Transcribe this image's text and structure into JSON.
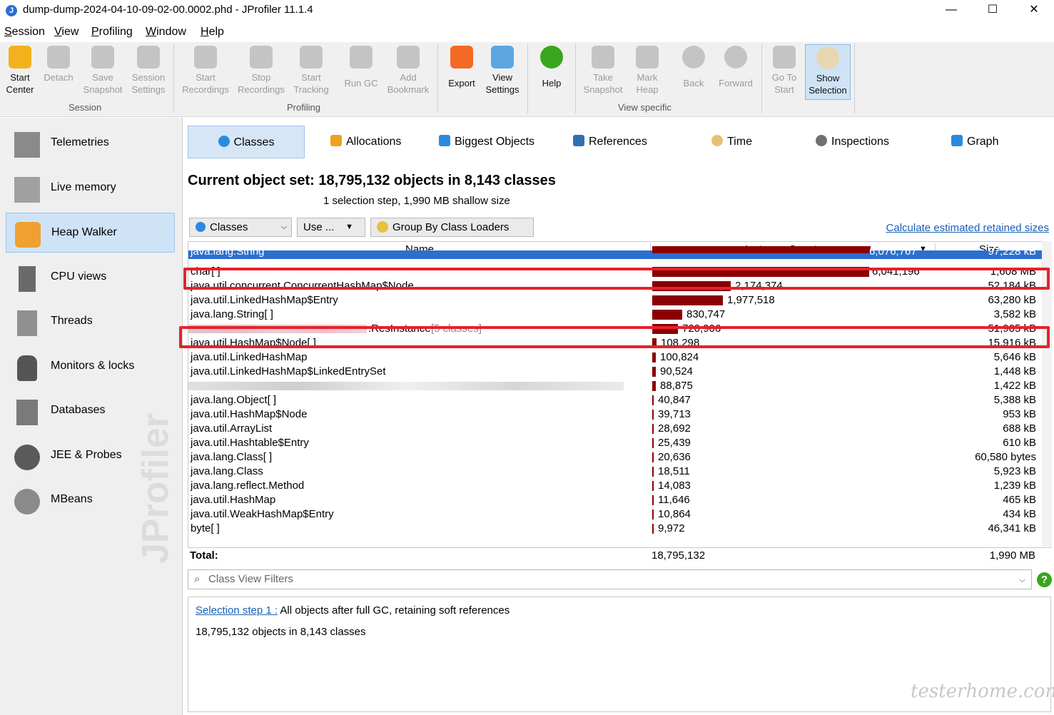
{
  "window": {
    "title": "dump-dump-2024-04-10-09-02-00.0002.phd - JProfiler 11.1.4",
    "minimize": "—",
    "maximize": "☐",
    "close": "✕"
  },
  "menu": [
    "Session",
    "View",
    "Profiling",
    "Window",
    "Help"
  ],
  "toolbar": {
    "buttons": [
      {
        "label": "Start\nCenter",
        "icon": "start-center-icon"
      },
      {
        "label": "Detach",
        "icon": "detach-icon"
      },
      {
        "label": "Save\nSnapshot",
        "icon": "save-snapshot-icon"
      },
      {
        "label": "Session\nSettings",
        "icon": "session-settings-icon"
      },
      {
        "label": "Start\nRecordings",
        "icon": "start-recordings-icon"
      },
      {
        "label": "Stop\nRecordings",
        "icon": "stop-recordings-icon"
      },
      {
        "label": "Start\nTracking",
        "icon": "start-tracking-icon"
      },
      {
        "label": "Run GC",
        "icon": "run-gc-icon"
      },
      {
        "label": "Add\nBookmark",
        "icon": "add-bookmark-icon"
      },
      {
        "label": "Export",
        "icon": "export-icon"
      },
      {
        "label": "View\nSettings",
        "icon": "view-settings-icon"
      },
      {
        "label": "Help",
        "icon": "help-icon"
      },
      {
        "label": "Take\nSnapshot",
        "icon": "take-snapshot-icon"
      },
      {
        "label": "Mark\nHeap",
        "icon": "mark-heap-icon"
      },
      {
        "label": "Back",
        "icon": "back-icon"
      },
      {
        "label": "Forward",
        "icon": "forward-icon"
      },
      {
        "label": "Go To\nStart",
        "icon": "go-to-start-icon"
      },
      {
        "label": "Show\nSelection",
        "icon": "show-selection-icon"
      }
    ],
    "groups": [
      "Session",
      "Profiling",
      "View specific"
    ]
  },
  "sidebar": {
    "items": [
      {
        "label": "Telemetries",
        "icon": "telemetries-icon"
      },
      {
        "label": "Live memory",
        "icon": "live-memory-icon"
      },
      {
        "label": "Heap Walker",
        "icon": "heap-walker-icon"
      },
      {
        "label": "CPU views",
        "icon": "cpu-views-icon"
      },
      {
        "label": "Threads",
        "icon": "threads-icon"
      },
      {
        "label": "Monitors & locks",
        "icon": "monitors-locks-icon"
      },
      {
        "label": "Databases",
        "icon": "databases-icon"
      },
      {
        "label": "JEE & Probes",
        "icon": "jee-probes-icon"
      },
      {
        "label": "MBeans",
        "icon": "mbeans-icon"
      }
    ],
    "watermark": "JProfiler"
  },
  "tabs": [
    "Classes",
    "Allocations",
    "Biggest Objects",
    "References",
    "Time",
    "Inspections",
    "Graph"
  ],
  "heading": {
    "title": "Current object set:  18,795,132 objects in 8,143 classes",
    "subtitle": "1 selection step, 1,990 MB shallow size"
  },
  "controls": {
    "view_select": "Classes",
    "use_button": "Use ...",
    "group_button": "Group By Class Loaders",
    "calc_link": "Calculate estimated retained sizes"
  },
  "table": {
    "columns": [
      "Name",
      "Instance Count",
      "Size"
    ],
    "rows": [
      {
        "name": "java.lang.String",
        "count": "6,076,767",
        "size": "97,228 kB",
        "fraction": 1.0
      },
      {
        "name": "char[ ]",
        "count": "6,041,196",
        "size": "1,608 MB",
        "fraction": 0.994
      },
      {
        "name": "java.util.concurrent.ConcurrentHashMap$Node",
        "count": "2,174,374",
        "size": "52,184 kB",
        "fraction": 0.358
      },
      {
        "name": "java.util.LinkedHashMap$Entry",
        "count": "1,977,518",
        "size": "63,280 kB",
        "fraction": 0.325
      },
      {
        "name": "java.lang.String[ ]",
        "count": "830,747",
        "size": "3,582 kB",
        "fraction": 0.137
      },
      {
        "name": ".ResInstance",
        "suffix": " [5 classes]",
        "count": "720,906",
        "size": "51,905 kB",
        "fraction": 0.119
      },
      {
        "name": "java.util.HashMap$Node[ ]",
        "count": "108,298",
        "size": "15,916 kB",
        "fraction": 0.018
      },
      {
        "name": "java.util.LinkedHashMap",
        "count": "100,824",
        "size": "5,646 kB",
        "fraction": 0.017
      },
      {
        "name": "java.util.LinkedHashMap$LinkedEntrySet",
        "count": "90,524",
        "size": "1,448 kB",
        "fraction": 0.015
      },
      {
        "name": "",
        "count": "88,875",
        "size": "1,422 kB",
        "fraction": 0.015
      },
      {
        "name": "java.lang.Object[ ]",
        "count": "40,847",
        "size": "5,388 kB",
        "fraction": 0.007
      },
      {
        "name": "java.util.HashMap$Node",
        "count": "39,713",
        "size": "953 kB",
        "fraction": 0.0065
      },
      {
        "name": "java.util.ArrayList",
        "count": "28,692",
        "size": "688 kB",
        "fraction": 0.0047
      },
      {
        "name": "java.util.Hashtable$Entry",
        "count": "25,439",
        "size": "610 kB",
        "fraction": 0.0042
      },
      {
        "name": "java.lang.Class[ ]",
        "count": "20,636",
        "size": "60,580 bytes",
        "fraction": 0.0034
      },
      {
        "name": "java.lang.Class",
        "count": "18,511",
        "size": "5,923 kB",
        "fraction": 0.003
      },
      {
        "name": "java.lang.reflect.Method",
        "count": "14,083",
        "size": "1,239 kB",
        "fraction": 0.0023
      },
      {
        "name": "java.util.HashMap",
        "count": "11,646",
        "size": "465 kB",
        "fraction": 0.0019
      },
      {
        "name": "java.util.WeakHashMap$Entry",
        "count": "10,864",
        "size": "434 kB",
        "fraction": 0.0018
      },
      {
        "name": "byte[ ]",
        "count": "9,972",
        "size": "46,341 kB",
        "fraction": 0.0016
      }
    ],
    "total": {
      "label": "Total:",
      "count": "18,795,132",
      "size": "1,990 MB"
    }
  },
  "filter": {
    "placeholder": "Class View Filters"
  },
  "selection": {
    "link": "Selection step 1 :",
    "text": " All objects after full GC, retaining soft references",
    "summary": "18,795,132 objects in 8,143 classes"
  },
  "corner_watermark": "testerhome.com",
  "colors": {
    "bar": "#8b0000",
    "highlight": "#2b6fd1",
    "annotation": "#e5222d",
    "link": "#1a5fb4"
  }
}
